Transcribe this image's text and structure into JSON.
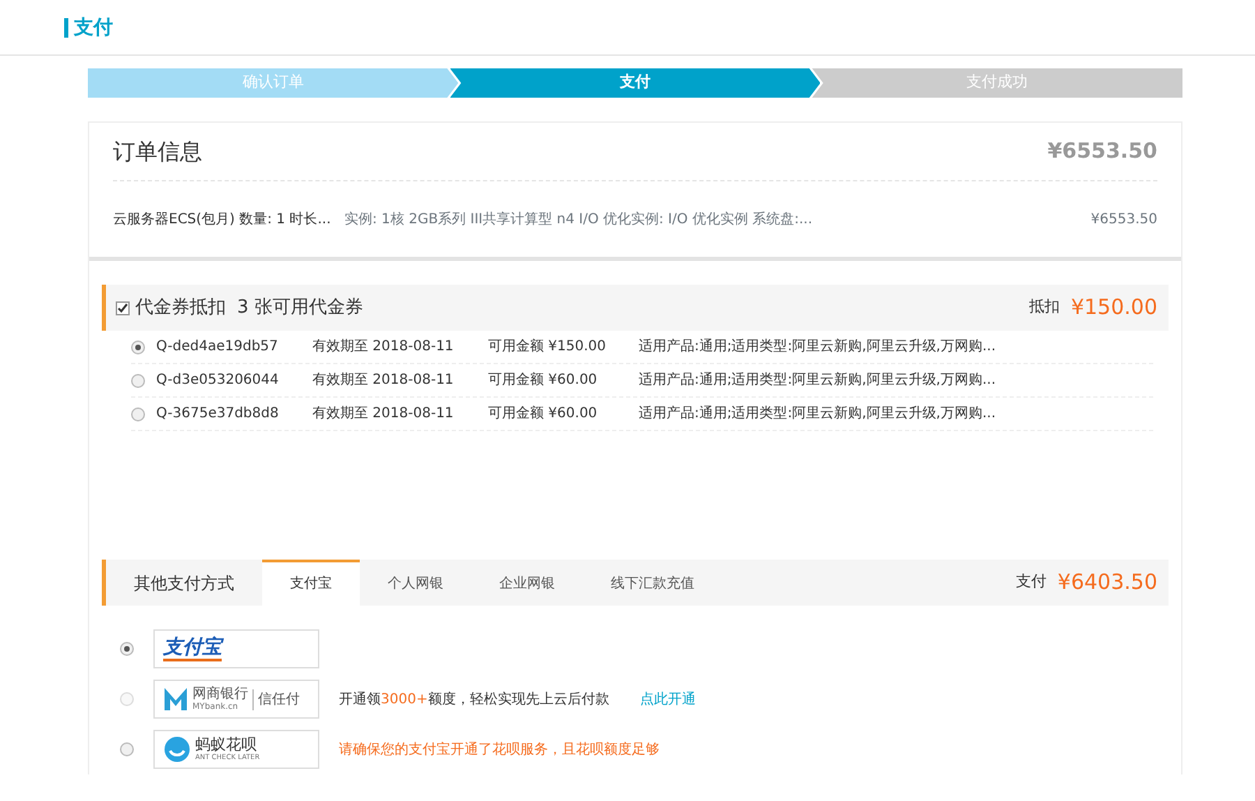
{
  "page_title": "支付",
  "steps": [
    {
      "label": "确认订单",
      "completed": true,
      "selected": false
    },
    {
      "label": "支付",
      "completed": false,
      "selected": true
    },
    {
      "label": "支付成功",
      "completed": false,
      "selected": false
    }
  ],
  "order": {
    "title": "订单信息",
    "total": "¥6553.50",
    "items": [
      {
        "name": "云服务器ECS(包月) 数量: 1 时长...",
        "spec": "实例: 1核 2GB系列 III共享计算型 n4 I/O 优化实例: I/O 优化实例 系统盘:...",
        "price": "¥6553.50"
      }
    ]
  },
  "vouchers": {
    "checked": true,
    "title": "代金券抵扣",
    "count": "3 张可用代金券",
    "deduct_label": "抵扣",
    "deduct_amount": "¥150.00",
    "items": [
      {
        "code": "Q-ded4ae19db57",
        "expiry": "有效期至 2018-08-11",
        "amount": "可用金额 ¥150.00",
        "scope": "适用产品:通用;适用类型:阿里云新购,阿里云升级,万网购...",
        "selected": true
      },
      {
        "code": "Q-d3e053206044",
        "expiry": "有效期至 2018-08-11",
        "amount": "可用金额 ¥60.00",
        "scope": "适用产品:通用;适用类型:阿里云新购,阿里云升级,万网购...",
        "selected": false
      },
      {
        "code": "Q-3675e37db8d8",
        "expiry": "有效期至 2018-08-11",
        "amount": "可用金额 ¥60.00",
        "scope": "适用产品:通用;适用类型:阿里云新购,阿里云升级,万网购...",
        "selected": false
      }
    ]
  },
  "payment": {
    "title": "其他支付方式",
    "pay_label": "支付",
    "pay_amount": "¥6403.50",
    "tabs": [
      {
        "label": "支付宝",
        "selected": true
      },
      {
        "label": "个人网银",
        "selected": false
      },
      {
        "label": "企业网银",
        "selected": false
      },
      {
        "label": "线下汇款充值",
        "selected": false
      }
    ],
    "methods": [
      {
        "kind": "alipay",
        "logo": [
          "支付宝"
        ],
        "selected": true,
        "disabled": false
      },
      {
        "kind": "mybank",
        "logo": [
          "网商银行",
          "MYbank.cn",
          "信任付"
        ],
        "selected": false,
        "disabled": true,
        "note": [
          {
            "text": "开通领",
            "highlight": false
          },
          {
            "text": "3000+",
            "highlight": true
          },
          {
            "text": "额度，轻松实现先上云后付款",
            "highlight": false
          }
        ],
        "link": "点此开通"
      },
      {
        "kind": "huabei",
        "logo": [
          "蚂蚁花呗",
          "ANT CHECK LATER"
        ],
        "selected": false,
        "disabled": false,
        "warning": "请确保您的支付宝开通了花呗服务，且花呗额度足够"
      }
    ]
  }
}
